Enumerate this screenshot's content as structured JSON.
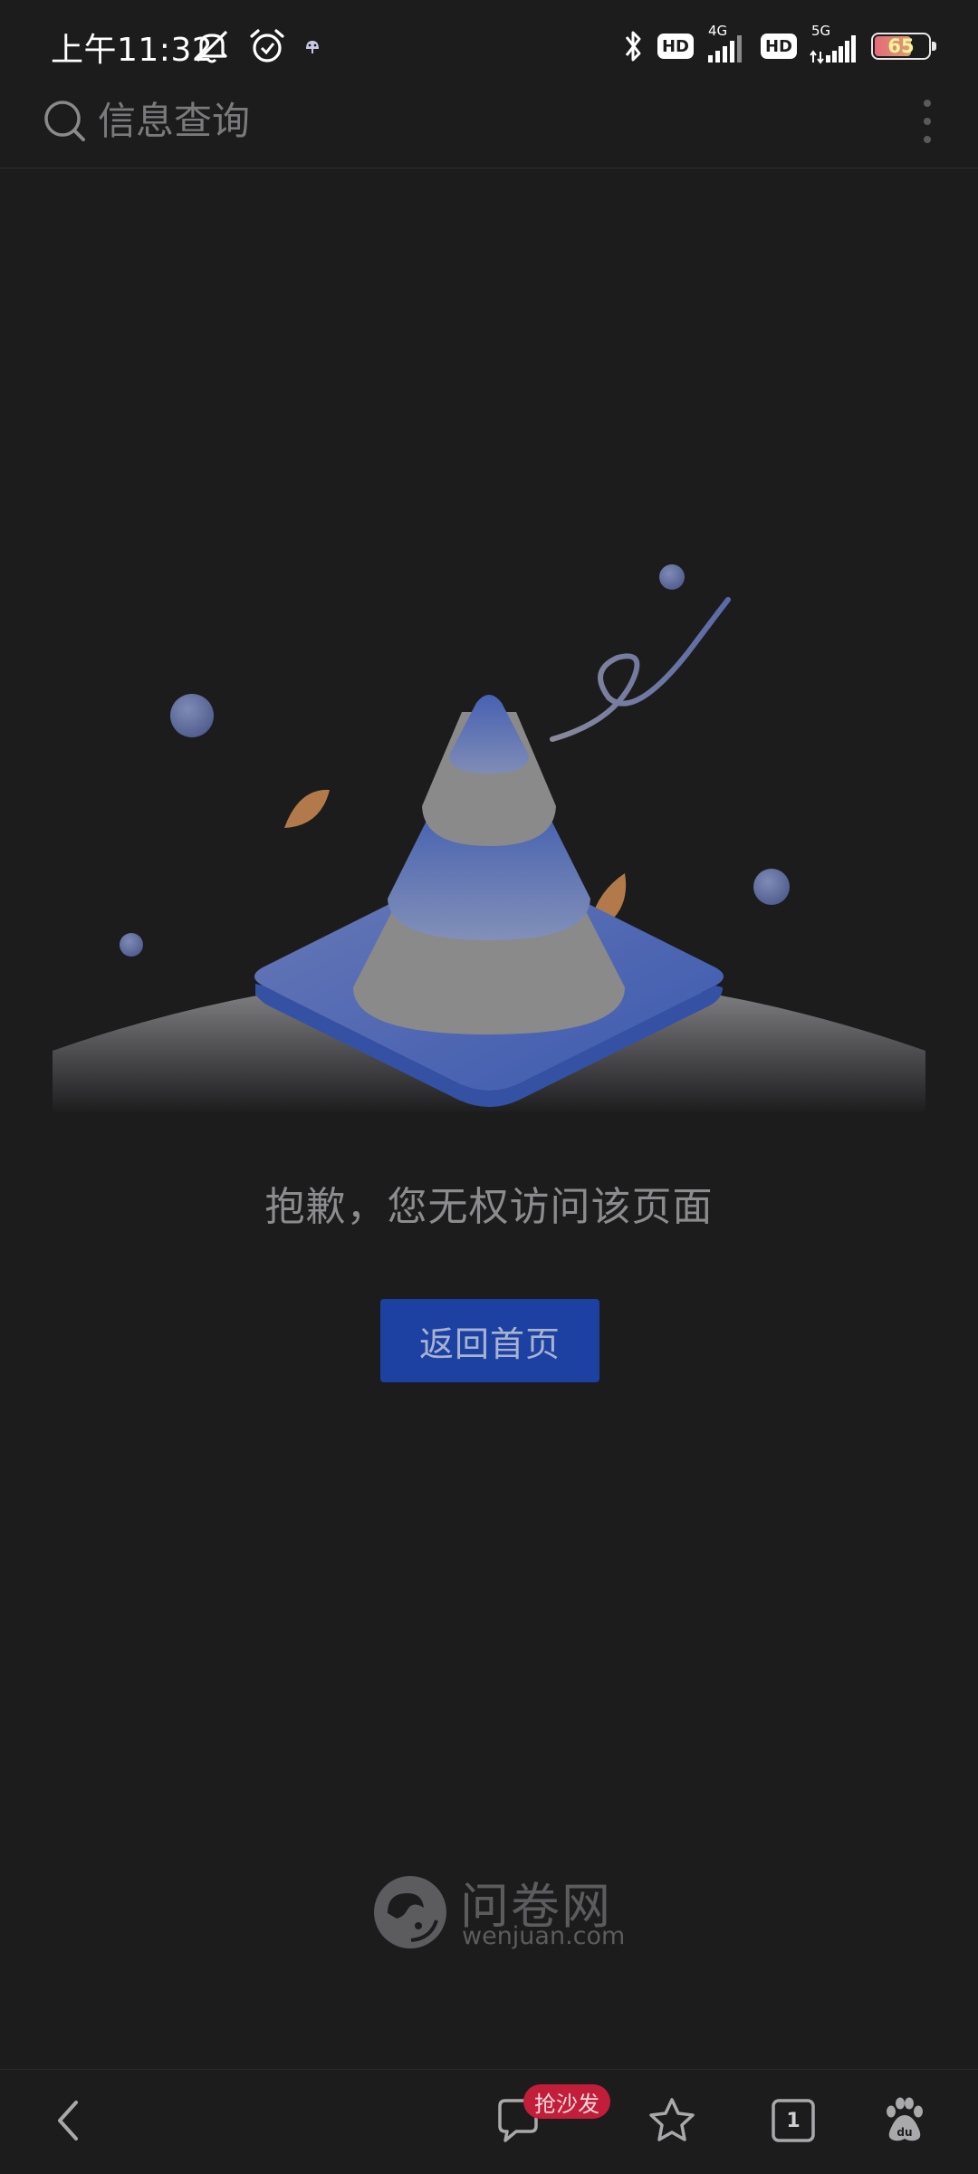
{
  "status_bar": {
    "time": "上午11:32",
    "network_1": "4G",
    "network_2": "5G",
    "hd_label": "HD",
    "battery_level": "65"
  },
  "search_bar": {
    "query": "信息查询"
  },
  "main": {
    "message": "抱歉，您无权访问该页面",
    "home_button_label": "返回首页"
  },
  "footer_logo": {
    "name": "问卷网",
    "domain": "wenjuan.com"
  },
  "bottom_nav": {
    "comment_badge": "抢沙发",
    "tab_count": "1"
  },
  "colors": {
    "background": "#1c1c1d",
    "button": "#1d41a2",
    "badge": "#c21e3a",
    "cone_blue": "#4a64b0"
  }
}
